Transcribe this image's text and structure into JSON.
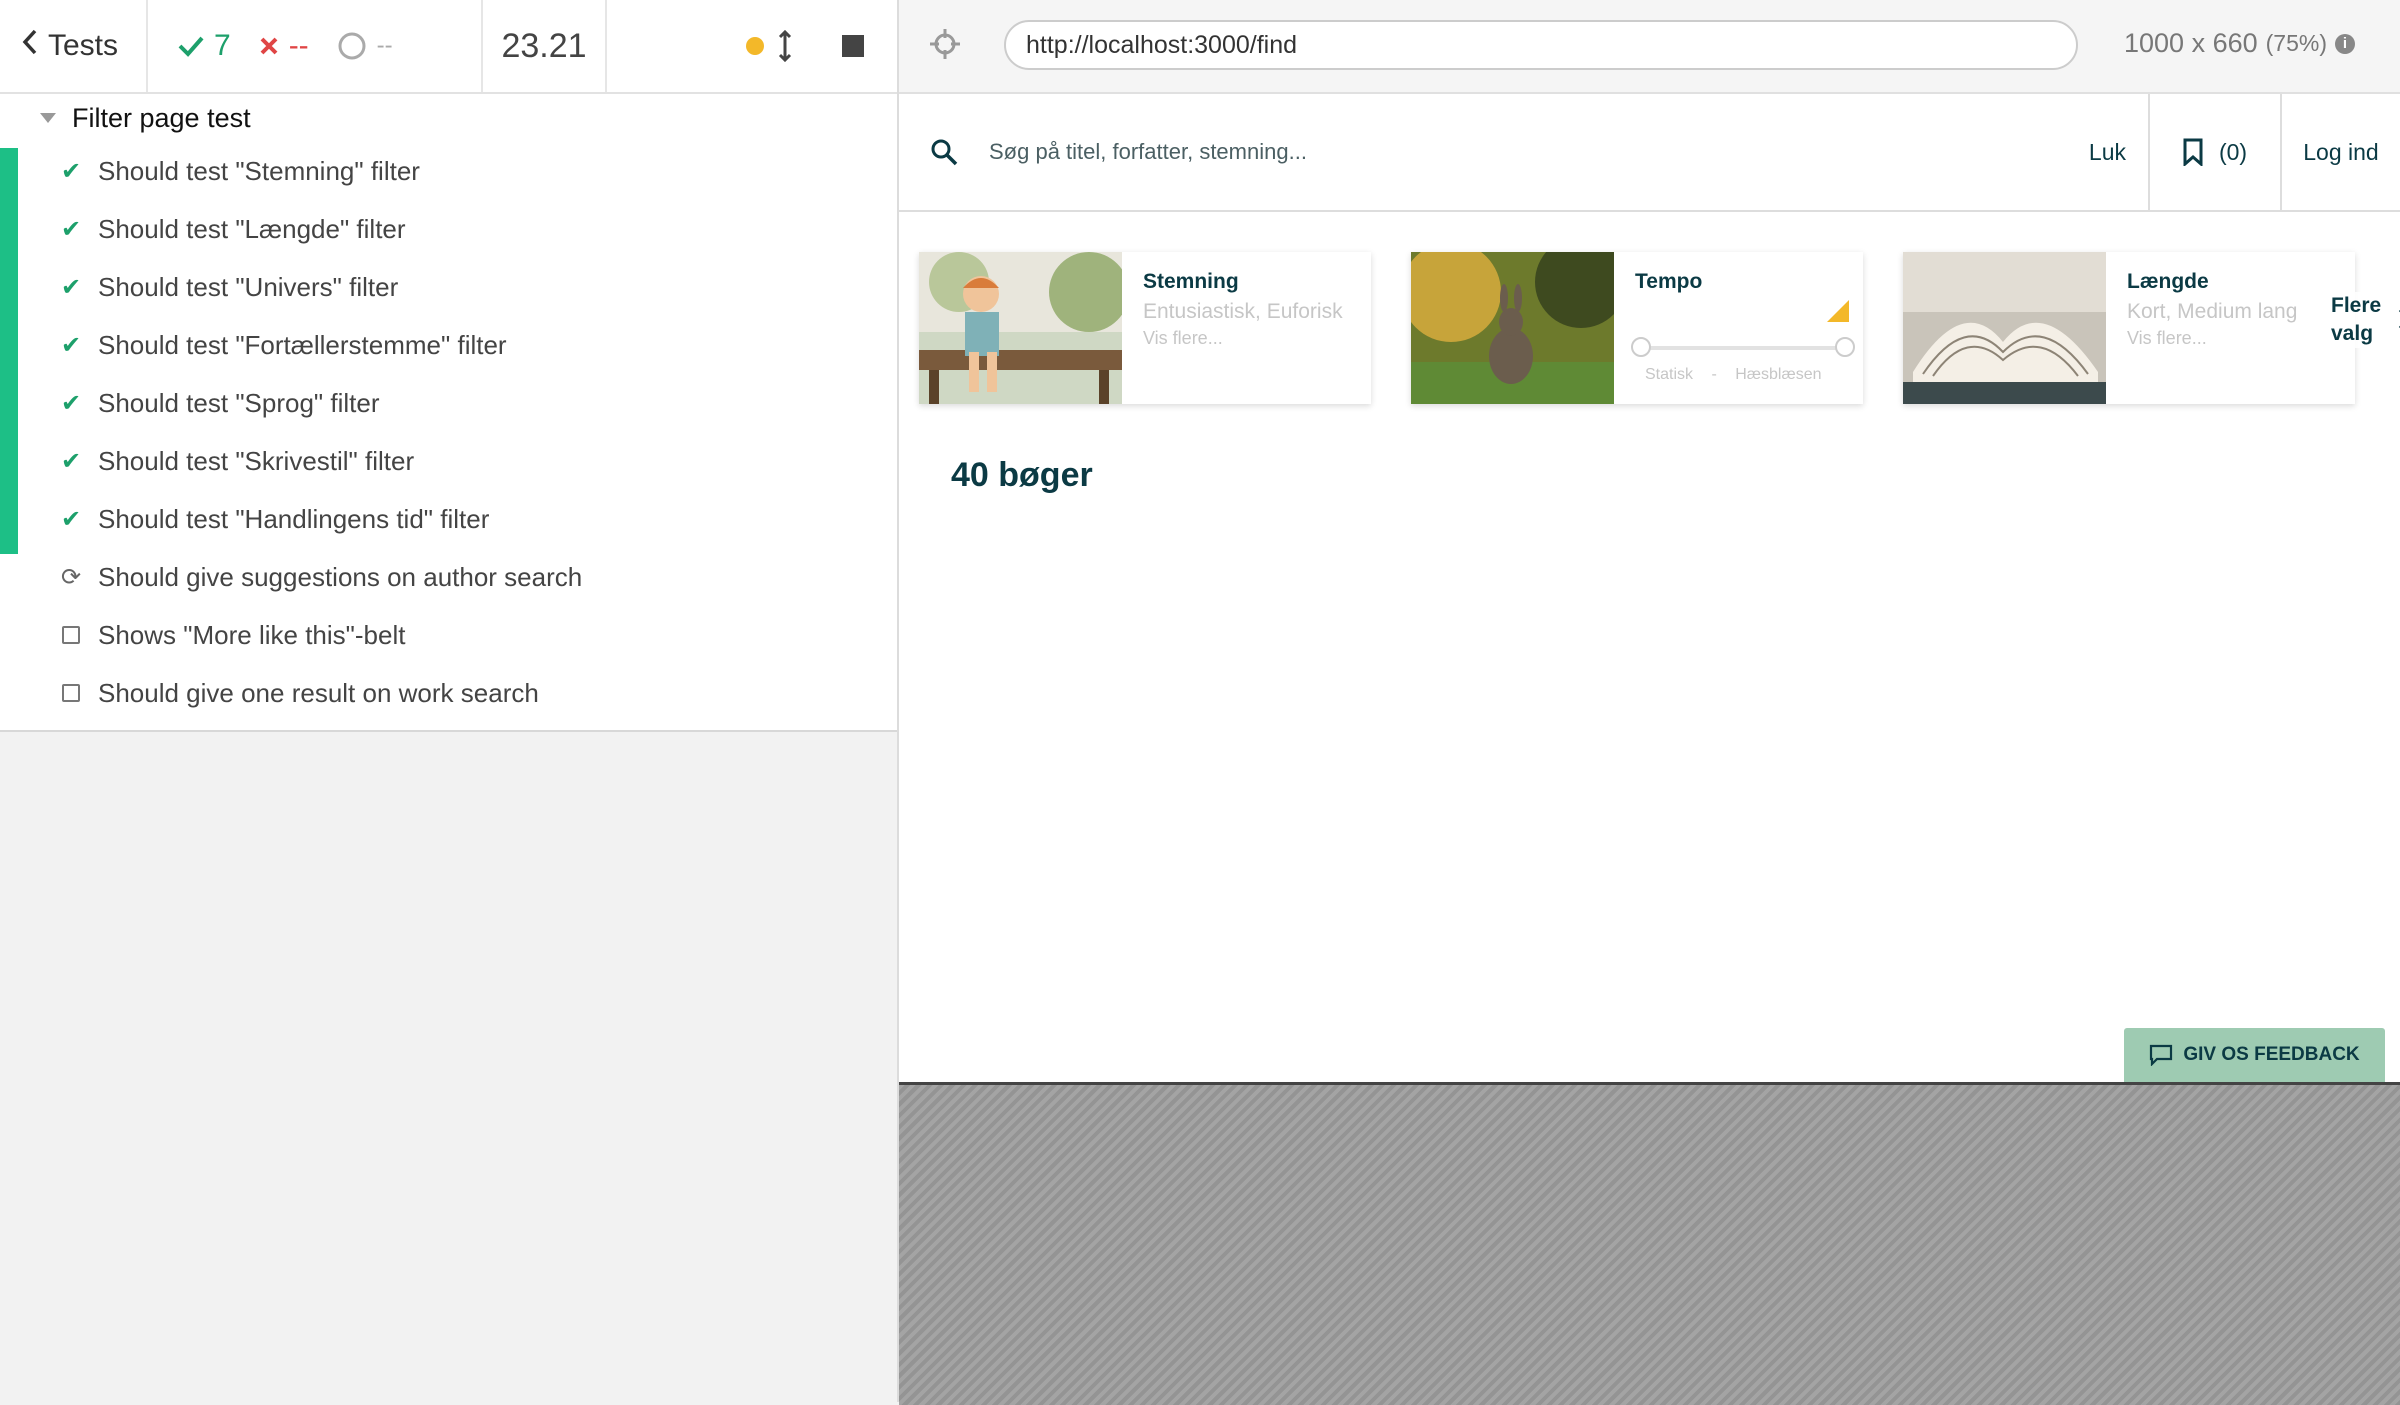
{
  "topbar": {
    "back_label": "Tests",
    "passed": "7",
    "failed": "--",
    "pending": "--",
    "duration": "23.21"
  },
  "reporter": {
    "suite_title": "Filter page test",
    "tests": [
      {
        "title": "Should test \"Stemning\" filter",
        "state": "passed"
      },
      {
        "title": "Should test \"Længde\" filter",
        "state": "passed"
      },
      {
        "title": "Should test \"Univers\" filter",
        "state": "passed"
      },
      {
        "title": "Should test \"Fortællerstemme\" filter",
        "state": "passed"
      },
      {
        "title": "Should test \"Sprog\" filter",
        "state": "passed"
      },
      {
        "title": "Should test \"Skrivestil\" filter",
        "state": "passed"
      },
      {
        "title": "Should test \"Handlingens tid\" filter",
        "state": "passed"
      },
      {
        "title": "Should give suggestions on author search",
        "state": "running"
      },
      {
        "title": "Shows \"More like this\"-belt",
        "state": "pending"
      },
      {
        "title": "Should give one result on work search",
        "state": "pending"
      }
    ]
  },
  "aut_bar": {
    "url": "http://localhost:3000/find",
    "viewport": "1000 x 660",
    "scale": "(75%)"
  },
  "site": {
    "search_placeholder": "Søg på titel, forfatter, stemning...",
    "close_label": "Luk",
    "bookmark_count": "(0)",
    "login_label": "Log ind",
    "cards": [
      {
        "title": "Stemning",
        "subtitle": "Entusiastisk, Euforisk",
        "more": "Vis flere..."
      },
      {
        "title": "Tempo",
        "left_label": "Statisk",
        "separator": "-",
        "right_label": "Hæsblæsende"
      },
      {
        "title": "Længde",
        "subtitle": "Kort, Medium lang",
        "more": "Vis flere..."
      }
    ],
    "more_choices_line1": "Flere",
    "more_choices_line2": "valg",
    "result_count": "40 bøger",
    "feedback_label": "GIV OS FEEDBACK"
  },
  "colors": {
    "pass": "#1da06b",
    "fail": "#e04545",
    "brand_dark": "#0b3a44",
    "feedback_bg": "#9ecbb2",
    "running_dot": "#f3b829"
  }
}
